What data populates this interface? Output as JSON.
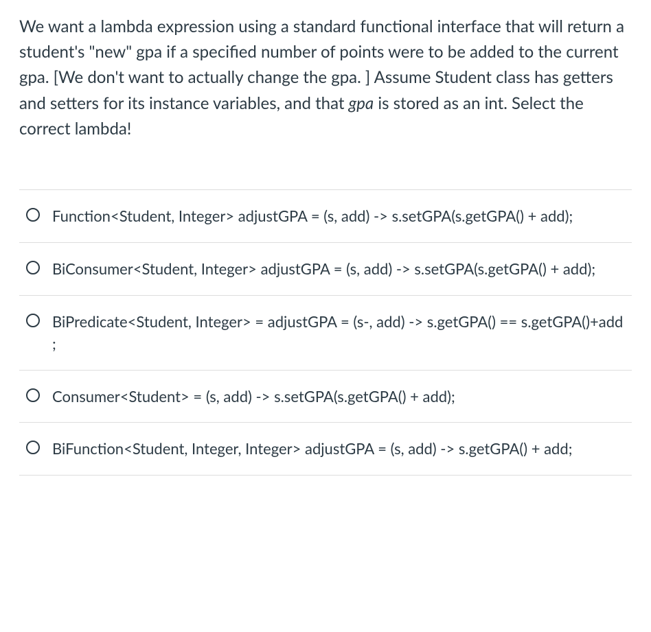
{
  "question": {
    "prompt_part1": "We want a lambda expression using a standard functional interface that will return a student's \"new\"  gpa if a specified number of points were to be added to the current gpa.  [We don't want to actually change the gpa. ]  Assume Student class has getters and setters for its instance variables, and that ",
    "prompt_italic": "gpa",
    "prompt_part2": " is stored as an int.  Select the correct lambda!"
  },
  "options": [
    {
      "text": "Function<Student, Integer> adjustGPA = (s, add) -> s.setGPA(s.getGPA() + add);"
    },
    {
      "text": "BiConsumer<Student, Integer> adjustGPA = (s, add) -> s.setGPA(s.getGPA() + add);"
    },
    {
      "text": "BiPredicate<Student, Integer> =  adjustGPA = (s-, add) -> s.getGPA()  ==  s.getGPA()+add ;"
    },
    {
      "text": "Consumer<Student> = (s, add) -> s.setGPA(s.getGPA() + add);"
    },
    {
      "text": "BiFunction<Student, Integer, Integer> adjustGPA = (s, add) -> s.getGPA() + add;"
    }
  ]
}
